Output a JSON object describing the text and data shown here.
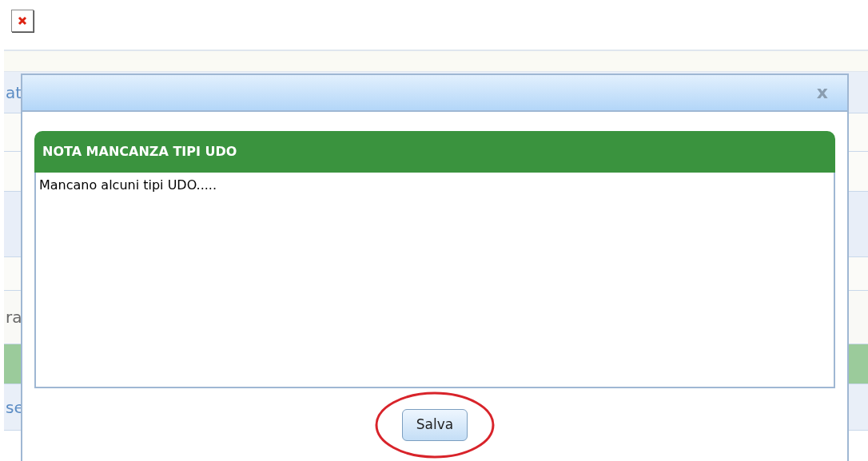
{
  "background": {
    "rows": [
      {
        "kind": "band"
      },
      {
        "kind": "link",
        "text": "at"
      },
      {
        "kind": "plain"
      },
      {
        "kind": "plain"
      },
      {
        "kind": "blue"
      },
      {
        "kind": "plain"
      },
      {
        "kind": "muted",
        "text": "ra"
      },
      {
        "kind": "green"
      },
      {
        "kind": "link",
        "text": "se"
      }
    ]
  },
  "dialog": {
    "close": "x",
    "section_title": "NOTA MANCANZA TIPI UDO",
    "note": {
      "value": "Mancano alcuni tipi UDO....."
    },
    "save_button": {
      "label": "Salva",
      "highlighted": true
    }
  }
}
